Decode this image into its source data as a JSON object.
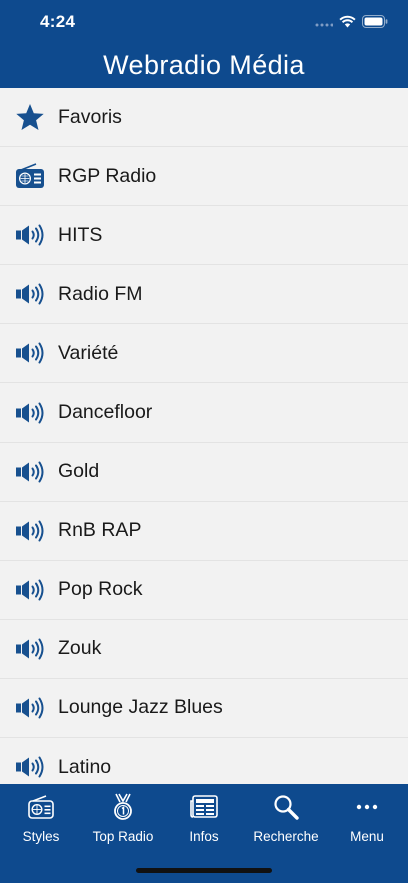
{
  "status": {
    "time": "4:24"
  },
  "header": {
    "title": "Webradio Média"
  },
  "list": [
    {
      "icon": "star-icon",
      "label": "Favoris"
    },
    {
      "icon": "radio-icon",
      "label": "RGP Radio"
    },
    {
      "icon": "speaker-icon",
      "label": "HITS"
    },
    {
      "icon": "speaker-icon",
      "label": "Radio FM"
    },
    {
      "icon": "speaker-icon",
      "label": "Variété"
    },
    {
      "icon": "speaker-icon",
      "label": "Dancefloor"
    },
    {
      "icon": "speaker-icon",
      "label": "Gold"
    },
    {
      "icon": "speaker-icon",
      "label": "RnB RAP"
    },
    {
      "icon": "speaker-icon",
      "label": "Pop Rock"
    },
    {
      "icon": "speaker-icon",
      "label": "Zouk"
    },
    {
      "icon": "speaker-icon",
      "label": "Lounge Jazz Blues"
    },
    {
      "icon": "speaker-icon",
      "label": "Latino"
    }
  ],
  "tabs": [
    {
      "icon": "radio-icon",
      "label": "Styles"
    },
    {
      "icon": "medal-icon",
      "label": "Top Radio"
    },
    {
      "icon": "newspaper-icon",
      "label": "Infos"
    },
    {
      "icon": "search-icon",
      "label": "Recherche"
    },
    {
      "icon": "more-icon",
      "label": "Menu"
    }
  ],
  "colors": {
    "brand": "#0e4a8e",
    "icon": "#17508f",
    "background": "#f2f2f2"
  }
}
